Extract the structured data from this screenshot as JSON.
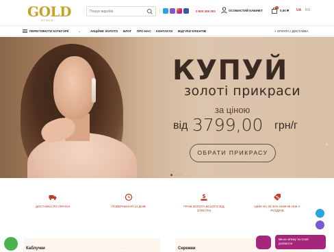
{
  "header": {
    "logo_text": "GOLD",
    "logo_sub": "STOCK",
    "search_placeholder": "Пошук виробів",
    "phone": "0 800 309 303",
    "cabinet_label": "ОСОБИСТИЙ КАБІНЕТ",
    "cart_count": "0",
    "cart_total": "0,00 ₴",
    "lang_active": "UA",
    "lang_other": "RU",
    "social_icons": [
      "telegram-icon",
      "viber-icon",
      "instagram-icon",
      "facebook-icon"
    ],
    "colors": {
      "gold": "#c9a028",
      "accent": "#c0392b"
    }
  },
  "nav": {
    "catalog_label": "ПЕРЕГЛЯНУТИ КАТЕГОРІЇ",
    "links": [
      "АКЦІЙНЕ ЗОЛОТО",
      "БЛОГ",
      "ПРО НАС",
      "КОНТАКТИ",
      "ВІДГУКИ КЛІЄНТІВ"
    ],
    "payment_label": "+ ОПЛАТА І ДОСТАВКА"
  },
  "hero": {
    "headline": "КУПУЙ",
    "subheadline": "золоті прикраси",
    "price_prefix": "за ціною",
    "from": "від",
    "price": "3799,00",
    "unit": "грн/г",
    "cta": "ОБРАТИ ПРИКРАСУ",
    "slide_count": 8,
    "active_slide": 5
  },
  "features": [
    {
      "icon": "truck-icon",
      "text": "ДОСТАВКА ПО УКРАЇНІ"
    },
    {
      "icon": "return-clock-icon",
      "text": "ПОВЕРНЕННЯ 14 ДНІВ"
    },
    {
      "icon": "gold-dollar-icon",
      "text": "ГРАМ ЗОЛОТА ВСЬОГО ВІД 3799 ГРН"
    },
    {
      "icon": "percent-tag-icon",
      "text": "ЦІНИ НА 30-40% НИЖЧЕ НІЖ У РОЗДРІБ"
    }
  ],
  "categories": [
    "Каблучки",
    "Сережки"
  ],
  "chat": {
    "message": "Ми на зв'язку та готові допомогти"
  },
  "colors": {
    "chat": "#a6267c",
    "whatsapp": "#4caf50",
    "telegram": "#2aa3df",
    "viber": "#7b58d6"
  }
}
